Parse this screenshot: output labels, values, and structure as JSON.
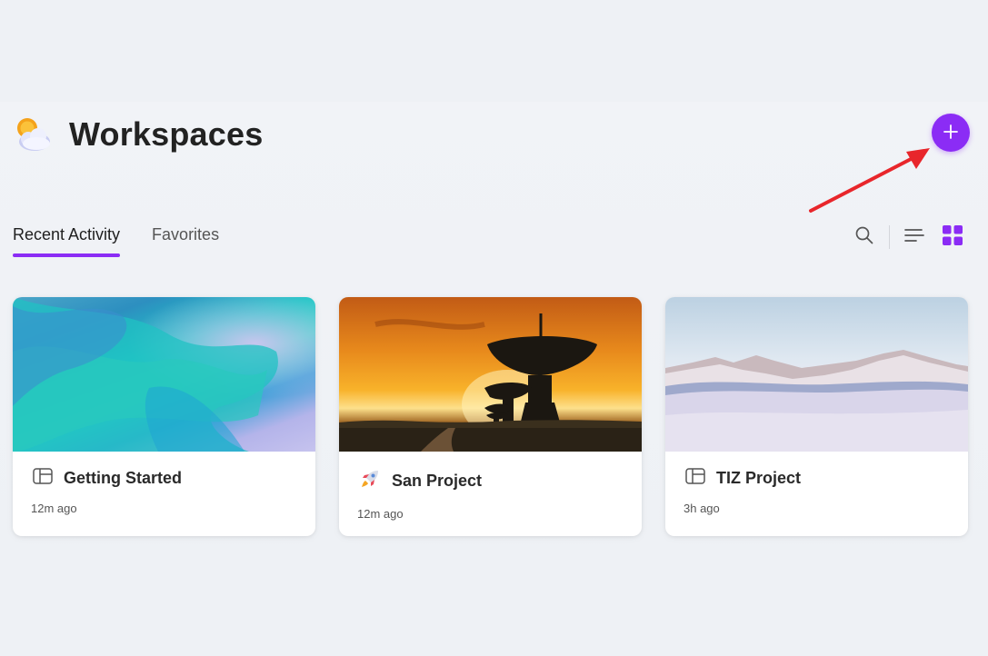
{
  "header": {
    "title": "Workspaces",
    "icon": "sun-behind-cloud-icon",
    "add_button_icon": "plus-icon"
  },
  "tabs": [
    {
      "label": "Recent Activity",
      "active": true
    },
    {
      "label": "Favorites",
      "active": false
    }
  ],
  "toolbar": {
    "search_icon": "search-icon",
    "list_view_icon": "list-view-icon",
    "grid_view_icon": "grid-view-icon",
    "active_view": "grid"
  },
  "cards": [
    {
      "title": "Getting Started",
      "time": "12m ago",
      "icon": "layout-icon",
      "image": "teal-silk-fabric"
    },
    {
      "title": "San Project",
      "time": "12m ago",
      "icon": "rocket-icon",
      "image": "radio-telescope-sunset"
    },
    {
      "title": "TIZ Project",
      "time": "3h ago",
      "icon": "layout-icon",
      "image": "snowy-mountains-desert"
    }
  ],
  "colors": {
    "accent": "#8b2cf5",
    "background": "#eef1f5",
    "annotation": "#e8262b"
  }
}
